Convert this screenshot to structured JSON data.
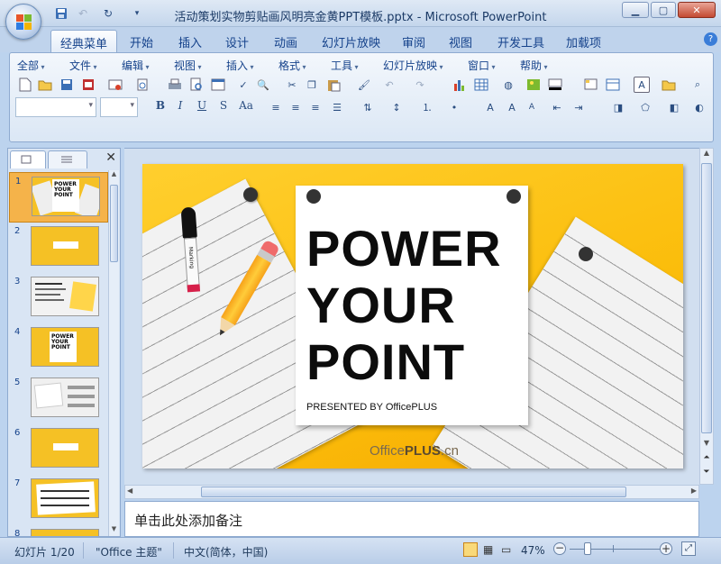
{
  "window": {
    "title": "活动策划实物剪贴画风明亮金黄PPT模板.pptx - Microsoft PowerPoint",
    "controls": [
      "minimize",
      "maximize",
      "close"
    ]
  },
  "ribbon_tabs": [
    {
      "label": "经典菜单",
      "active": true
    },
    {
      "label": "开始"
    },
    {
      "label": "插入"
    },
    {
      "label": "设计"
    },
    {
      "label": "动画"
    },
    {
      "label": "幻灯片放映"
    },
    {
      "label": "审阅"
    },
    {
      "label": "视图"
    },
    {
      "label": "开发工具"
    },
    {
      "label": "加载项"
    }
  ],
  "menu": [
    "全部",
    "文件",
    "编辑",
    "视图",
    "插入",
    "格式",
    "工具",
    "幻灯片放映",
    "窗口",
    "帮助"
  ],
  "format_buttons": [
    "B",
    "I",
    "U",
    "S",
    "Aa"
  ],
  "slides_panel": {
    "slide_numbers": [
      "1",
      "2",
      "3",
      "4",
      "5",
      "6",
      "7",
      "8"
    ],
    "selected": 1
  },
  "slide": {
    "title_line1": "POWER",
    "title_line2": "YOUR",
    "title_line3": "POINT",
    "presented_by": "PRESENTED BY OfficePLUS",
    "brand_office": "Office",
    "brand_plus": "PLUS",
    "brand_cn": ".cn",
    "marker_text": "Marking"
  },
  "thumb_texts": {
    "t1": [
      "POWER",
      "YOUR",
      "POINT"
    ]
  },
  "notes_placeholder": "单击此处添加备注",
  "status": {
    "slide_counter": "幻灯片 1/20",
    "theme": "\"Office 主题\"",
    "language": "中文(简体，中国)",
    "zoom": "47%"
  },
  "colors": {
    "slide_yellow": "#fbbd0b",
    "selected_thumb": "#f5b34a",
    "ribbon_blue": "#bfd3ec"
  }
}
